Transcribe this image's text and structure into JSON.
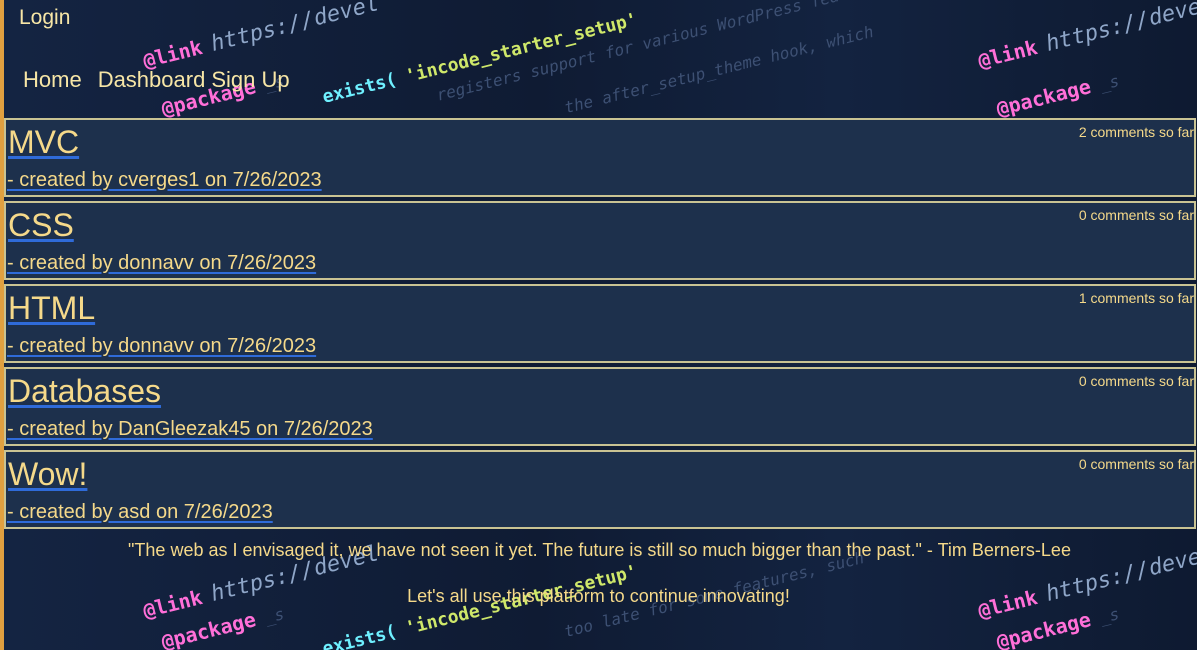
{
  "header": {
    "login_label": "Login"
  },
  "nav": {
    "items": [
      {
        "label": "Home"
      },
      {
        "label": "Dashboard"
      },
      {
        "label": "Sign Up"
      }
    ]
  },
  "posts": [
    {
      "title": "MVC",
      "meta": "- created by cverges1 on 7/26/2023",
      "comments": "2 comments so far"
    },
    {
      "title": "CSS",
      "meta": "- created by donnavv on 7/26/2023",
      "comments": "0 comments so far"
    },
    {
      "title": "HTML",
      "meta": "- created by donnavv on 7/26/2023",
      "comments": "1 comments so far"
    },
    {
      "title": "Databases",
      "meta": "- created by DanGleezak45 on 7/26/2023",
      "comments": "0 comments so far"
    },
    {
      "title": "Wow!",
      "meta": "- created by asd on 7/26/2023",
      "comments": "0 comments so far"
    }
  ],
  "footer": {
    "quote": "\"The web as I envisaged it, we have not seen it yet. The future is still so much bigger than the past.\" - Tim Berners-Lee",
    "tagline": "Let's all use this platform to continue innovating!"
  },
  "background": {
    "snippets": [
      "@link",
      "https://devel",
      "@package",
      "_s",
      "exists(",
      "'incode_starter_setup'",
      "registers support for various WordPress features",
      "the after_setup_theme hook, which",
      "too late for some features, such"
    ]
  },
  "colors": {
    "text": "#f5d98a",
    "card_bg": "#1d304c",
    "card_border": "#c9c393",
    "link_underline": "#2f6bd9",
    "accent_stripe": "#e0a040"
  }
}
